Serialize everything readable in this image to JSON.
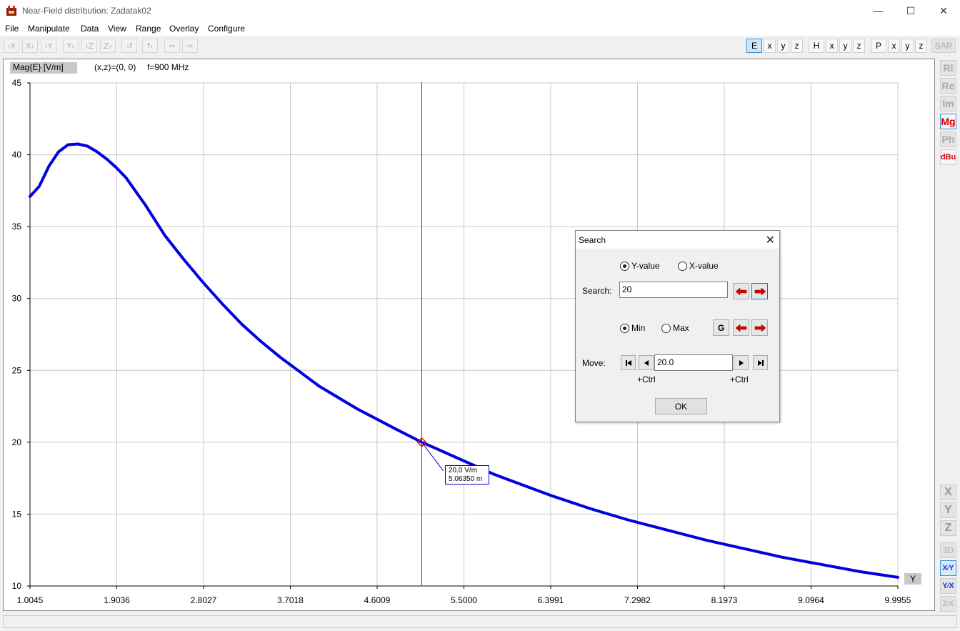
{
  "window": {
    "title": "Near-Field distribution: Zadatak02",
    "minimize_glyph": "—",
    "maximize_glyph": "☐",
    "close_glyph": "✕"
  },
  "menu": [
    "File",
    "Manipulate",
    "Data",
    "View",
    "Range",
    "Overlay",
    "Configure"
  ],
  "toolbar": {
    "nav_buttons": [
      "‹X",
      "X›",
      "‹Y",
      "Y›",
      "‹Z",
      "Z›",
      "‹f",
      "f›",
      "⇦",
      "⇨"
    ],
    "field_groups": [
      {
        "main": "E",
        "comps": [
          "x",
          "y",
          "z"
        ],
        "active": "E"
      },
      {
        "main": "H",
        "comps": [
          "x",
          "y",
          "z"
        ]
      },
      {
        "main": "P",
        "comps": [
          "x",
          "y",
          "z"
        ]
      }
    ],
    "sar_label": "SAR"
  },
  "plot": {
    "quantity_label": "Mag{E} [V/m]",
    "position_label": "(x,z)=(0, 0)",
    "frequency_label": "f=900 MHz",
    "axis_button": "Y",
    "cursor_tooltip": {
      "value": "20.0 V/m",
      "position": "5.06350 m"
    }
  },
  "chart_data": {
    "type": "line",
    "xlabel": "Y",
    "ylabel": "Mag{E} [V/m]",
    "xlim": [
      1.0045,
      9.9955
    ],
    "ylim": [
      10,
      45
    ],
    "x_ticks": [
      "1.0045",
      "1.9036",
      "2.8027",
      "3.7018",
      "4.6009",
      "5.5000",
      "6.3991",
      "7.2982",
      "8.1973",
      "9.0964",
      "9.9955"
    ],
    "y_ticks": [
      "10",
      "15",
      "20",
      "25",
      "30",
      "35",
      "40",
      "45"
    ],
    "grid": true,
    "series": [
      {
        "color": "#0000e0",
        "x": [
          1.0045,
          1.1,
          1.2,
          1.3,
          1.4,
          1.5,
          1.6,
          1.7,
          1.8,
          1.9,
          2.0,
          2.2,
          2.4,
          2.6,
          2.8,
          3.0,
          3.2,
          3.4,
          3.6,
          3.8,
          4.0,
          4.2,
          4.4,
          4.6,
          4.8,
          5.0636,
          5.2,
          5.4,
          5.6,
          5.8,
          6.0,
          6.4,
          6.8,
          7.2,
          7.6,
          8.0,
          8.4,
          8.8,
          9.2,
          9.6,
          9.9955
        ],
        "y": [
          37.1,
          37.8,
          39.2,
          40.2,
          40.7,
          40.75,
          40.6,
          40.2,
          39.7,
          39.1,
          38.4,
          36.5,
          34.4,
          32.7,
          31.1,
          29.6,
          28.2,
          27.0,
          25.9,
          24.9,
          23.9,
          23.1,
          22.3,
          21.6,
          20.9,
          20.0,
          19.6,
          19.0,
          18.4,
          17.8,
          17.3,
          16.3,
          15.4,
          14.6,
          13.9,
          13.2,
          12.6,
          12.0,
          11.5,
          11.0,
          10.6
        ]
      }
    ],
    "cursor": {
      "x": 5.0635,
      "y": 20.0,
      "color": "#e00000"
    }
  },
  "side_buttons": {
    "top": [
      "Rl",
      "Re",
      "Im",
      "Mg",
      "Ph",
      "dBu"
    ],
    "bottom": [
      "X",
      "Y",
      "Z",
      "3D",
      "X⁄Y",
      "Y⁄X",
      "Z⁄X"
    ]
  },
  "search_dialog": {
    "title": "Search",
    "close_glyph": "✕",
    "mode_yvalue": "Y-value",
    "mode_xvalue": "X-value",
    "search_label": "Search:",
    "search_value": "20",
    "min_label": "Min",
    "max_label": "Max",
    "g_label": "G",
    "move_label": "Move:",
    "move_value": "20.0",
    "ctrl_left": "+Ctrl",
    "ctrl_right": "+Ctrl",
    "ok_label": "OK"
  }
}
